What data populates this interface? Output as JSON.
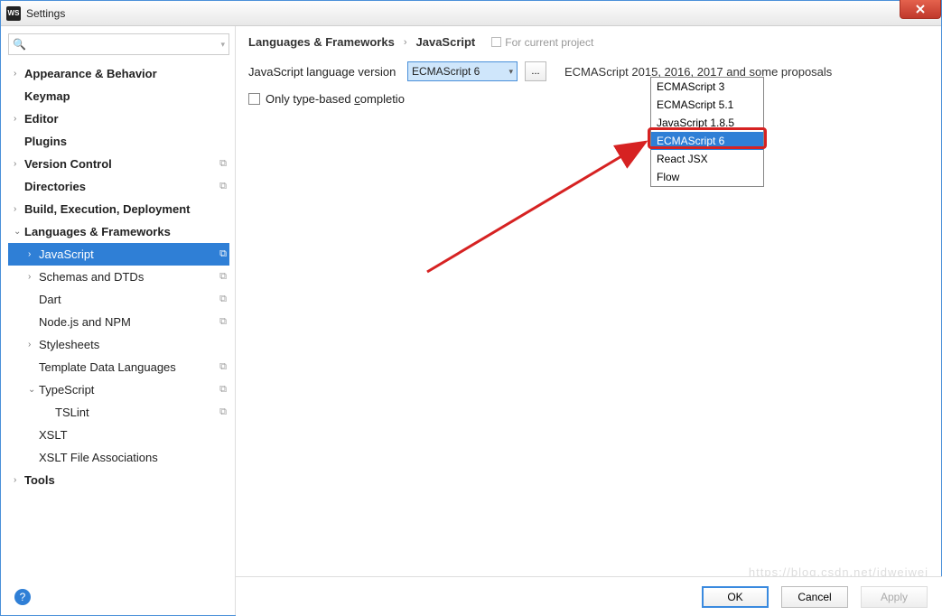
{
  "window": {
    "title": "Settings",
    "app_icon_text": "WS"
  },
  "search": {
    "placeholder": ""
  },
  "sidebar": {
    "items": [
      {
        "label": "Appearance & Behavior",
        "arrow": ">",
        "bold": true,
        "depth": 0
      },
      {
        "label": "Keymap",
        "arrow": "",
        "bold": true,
        "depth": 0
      },
      {
        "label": "Editor",
        "arrow": ">",
        "bold": true,
        "depth": 0
      },
      {
        "label": "Plugins",
        "arrow": "",
        "bold": true,
        "depth": 0
      },
      {
        "label": "Version Control",
        "arrow": ">",
        "bold": true,
        "depth": 0,
        "copy": true
      },
      {
        "label": "Directories",
        "arrow": "",
        "bold": true,
        "depth": 0,
        "copy": true
      },
      {
        "label": "Build, Execution, Deployment",
        "arrow": ">",
        "bold": true,
        "depth": 0
      },
      {
        "label": "Languages & Frameworks",
        "arrow": "v",
        "bold": true,
        "depth": 0
      },
      {
        "label": "JavaScript",
        "arrow": ">",
        "bold": false,
        "depth": 1,
        "selected": true,
        "copy": true
      },
      {
        "label": "Schemas and DTDs",
        "arrow": ">",
        "bold": false,
        "depth": 1,
        "copy": true
      },
      {
        "label": "Dart",
        "arrow": "",
        "bold": false,
        "depth": 1,
        "copy": true
      },
      {
        "label": "Node.js and NPM",
        "arrow": "",
        "bold": false,
        "depth": 1,
        "copy": true
      },
      {
        "label": "Stylesheets",
        "arrow": ">",
        "bold": false,
        "depth": 1
      },
      {
        "label": "Template Data Languages",
        "arrow": "",
        "bold": false,
        "depth": 1,
        "copy": true
      },
      {
        "label": "TypeScript",
        "arrow": "v",
        "bold": false,
        "depth": 1,
        "copy": true
      },
      {
        "label": "TSLint",
        "arrow": "",
        "bold": false,
        "depth": 2,
        "copy": true
      },
      {
        "label": "XSLT",
        "arrow": "",
        "bold": false,
        "depth": 1
      },
      {
        "label": "XSLT File Associations",
        "arrow": "",
        "bold": false,
        "depth": 1
      },
      {
        "label": "Tools",
        "arrow": ">",
        "bold": true,
        "depth": 0
      }
    ]
  },
  "breadcrumb": {
    "seg1": "Languages & Frameworks",
    "seg2": "JavaScript",
    "context": "For current project"
  },
  "form": {
    "version_label": "JavaScript language version",
    "version_selected": "ECMAScript 6",
    "version_options": [
      "ECMAScript 3",
      "ECMAScript 5.1",
      "JavaScript 1.8.5",
      "ECMAScript 6",
      "React JSX",
      "Flow"
    ],
    "highlighted_option_index": 3,
    "description": "ECMAScript 2015, 2016, 2017 and some proposals",
    "checkbox_label_pre": "Only type-based ",
    "checkbox_label_und": "c",
    "checkbox_label_post": "ompletio"
  },
  "footer": {
    "ok": "OK",
    "cancel": "Cancel",
    "apply": "Apply"
  },
  "help": "?",
  "watermark": "https://blog.csdn.net/idweiwei"
}
